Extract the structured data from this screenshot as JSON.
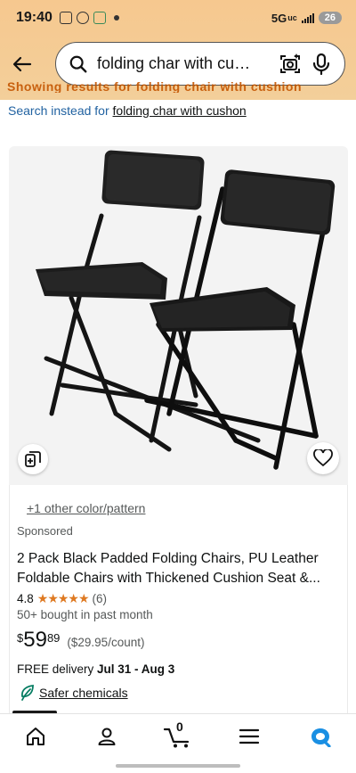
{
  "status_bar": {
    "time": "19:40",
    "network": "5G",
    "network_sub": "uc",
    "battery": "26"
  },
  "search": {
    "query": "folding char with cu…"
  },
  "notice": {
    "showing_strip": "Showing results for folding chair with cushion",
    "search_instead_prefix": "Search instead for ",
    "search_instead_link": "folding char with cushon"
  },
  "product": {
    "color_link": "+1 other color/pattern",
    "sponsored": "Sponsored",
    "title_line1": "2 Pack Black Padded Folding Chairs, PU Leather",
    "title_line2": "Foldable Chairs with Thickened Cushion Seat &...",
    "rating": "4.8",
    "stars": "★★★★★",
    "rating_count": "(6)",
    "bought": "50+ bought in past month",
    "price_symbol": "$",
    "price_whole": "59",
    "price_fraction": "89",
    "unit_price": "($29.95/count)",
    "delivery_prefix": "FREE delivery ",
    "delivery_dates": "Jul 31 - Aug 3",
    "safer_label": "Safer chemicals"
  },
  "bottom_nav": {
    "cart_count": "0"
  },
  "colors": {
    "header": "#f6c88f",
    "star": "#de7921",
    "link": "#2162a1",
    "safer_green": "#067d62",
    "accent_blue": "#1a8fe3"
  },
  "icons": [
    "back-arrow-icon",
    "search-icon",
    "camera-lens-icon",
    "microphone-icon",
    "compare-icon",
    "heart-icon",
    "leaf-icon",
    "home-icon",
    "account-icon",
    "cart-icon",
    "menu-icon",
    "rufus-icon"
  ]
}
